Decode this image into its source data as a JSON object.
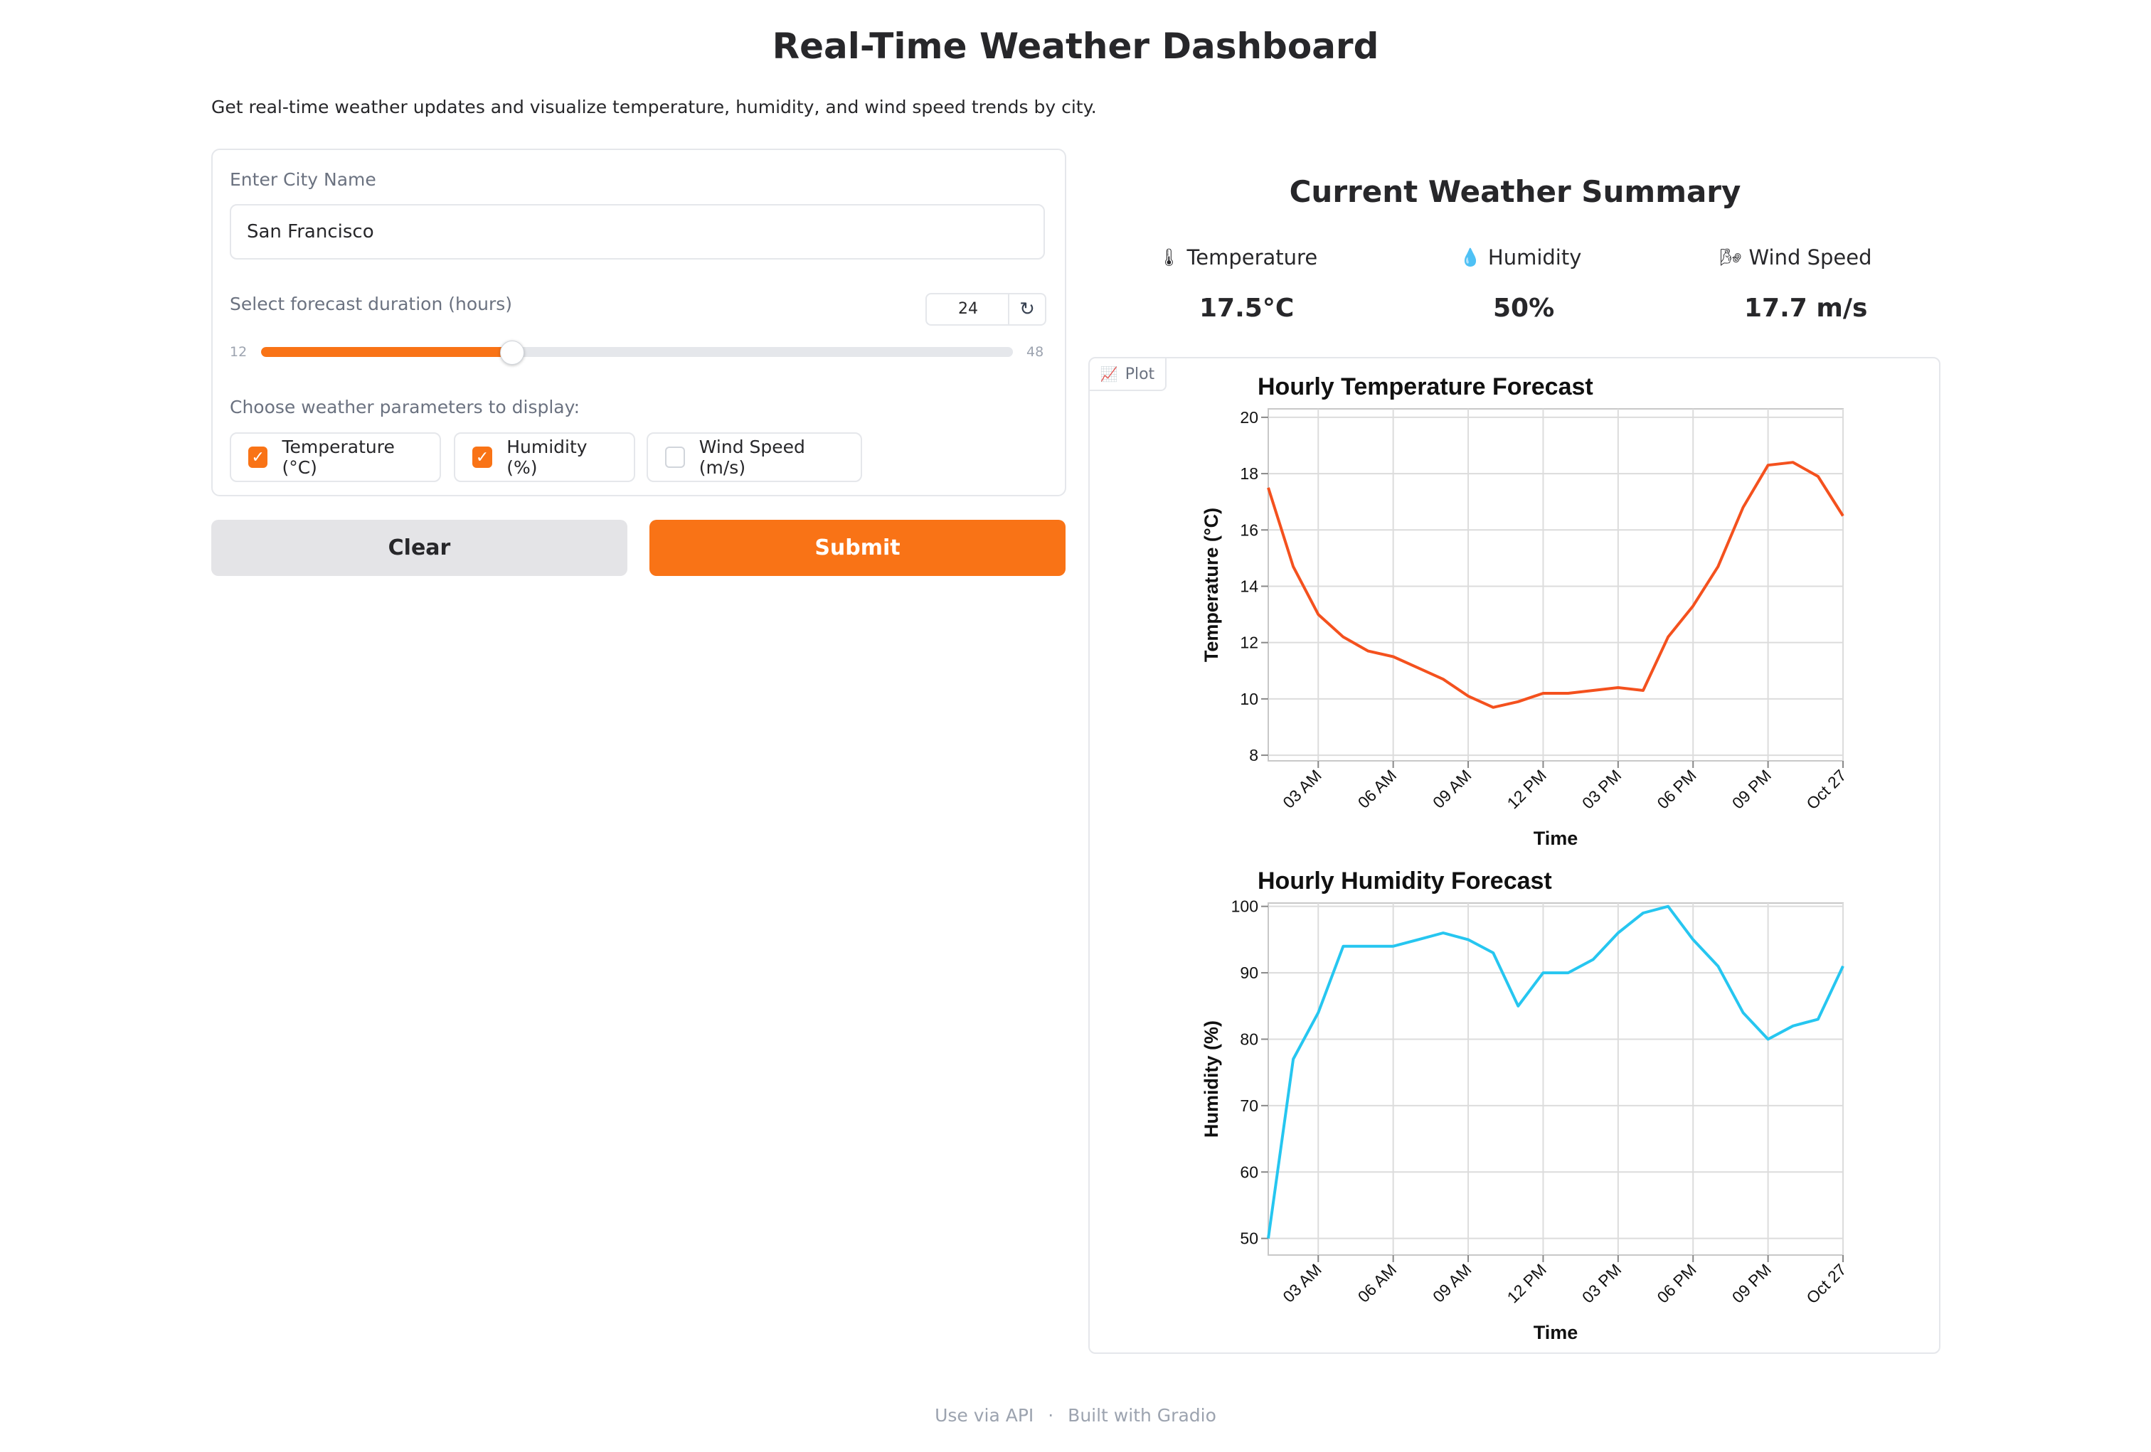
{
  "header": {
    "title": "Real-Time Weather Dashboard",
    "description": "Get real-time weather updates and visualize temperature, humidity, and wind speed trends by city."
  },
  "form": {
    "city_label": "Enter City Name",
    "city_value": "San Francisco",
    "duration_label": "Select forecast duration (hours)",
    "duration_value": "24",
    "duration_min": "12",
    "duration_max": "48",
    "duration_fraction": 0.333,
    "reset_icon": "↻",
    "params_label": "Choose weather parameters to display:",
    "params": [
      {
        "label": "Temperature (°C)",
        "checked": true
      },
      {
        "label": "Humidity (%)",
        "checked": true
      },
      {
        "label": "Wind Speed (m/s)",
        "checked": false
      }
    ],
    "check_mark": "✓"
  },
  "buttons": {
    "clear": "Clear",
    "submit": "Submit"
  },
  "summary": {
    "title": "Current Weather Summary",
    "metrics": [
      {
        "icon": "🌡",
        "label": "Temperature",
        "value": "17.5°C"
      },
      {
        "icon": "💧",
        "label": "Humidity",
        "value": "50%"
      },
      {
        "icon": "🌬",
        "label": "Wind Speed",
        "value": "17.7 m/s"
      }
    ]
  },
  "plot": {
    "tab_icon": "📈",
    "tab_label": "Plot"
  },
  "chart_data": [
    {
      "type": "line",
      "title": "Hourly Temperature Forecast",
      "xlabel": "Time",
      "ylabel": "Temperature (°C)",
      "ylim": [
        7.8,
        20.3
      ],
      "yticks": [
        8,
        10,
        12,
        14,
        16,
        18,
        20
      ],
      "xtick_labels": [
        "03 AM",
        "06 AM",
        "09 AM",
        "12 PM",
        "03 PM",
        "06 PM",
        "09 PM",
        "Oct 27"
      ],
      "grid": true,
      "color": "#f4511e",
      "x_hours": [
        0,
        1,
        2,
        3,
        4,
        5,
        6,
        7,
        8,
        9,
        10,
        11,
        12,
        13,
        14,
        15,
        16,
        17,
        18,
        19,
        20,
        21,
        22,
        23
      ],
      "values": [
        17.5,
        14.7,
        13.0,
        12.2,
        11.7,
        11.5,
        11.1,
        10.7,
        10.1,
        9.7,
        9.9,
        10.2,
        10.2,
        10.3,
        10.4,
        10.3,
        12.2,
        13.3,
        14.7,
        16.8,
        18.3,
        18.4,
        17.9,
        16.5
      ]
    },
    {
      "type": "line",
      "title": "Hourly Humidity Forecast",
      "xlabel": "Time",
      "ylabel": "Humidity (%)",
      "ylim": [
        47.5,
        100.5
      ],
      "yticks": [
        50,
        60,
        70,
        80,
        90,
        100
      ],
      "xtick_labels": [
        "03 AM",
        "06 AM",
        "09 AM",
        "12 PM",
        "03 PM",
        "06 PM",
        "09 PM",
        "Oct 27"
      ],
      "grid": true,
      "color": "#26c6f0",
      "x_hours": [
        0,
        1,
        2,
        3,
        4,
        5,
        6,
        7,
        8,
        9,
        10,
        11,
        12,
        13,
        14,
        15,
        16,
        17,
        18,
        19,
        20,
        21,
        22,
        23
      ],
      "values": [
        50,
        77,
        84,
        94,
        94,
        94,
        95,
        96,
        95,
        93,
        85,
        90,
        90,
        92,
        96,
        99,
        100,
        95,
        91,
        84,
        80,
        82,
        83,
        91
      ]
    }
  ],
  "footer": {
    "api": "Use via API",
    "separator": "·",
    "built": "Built with Gradio"
  }
}
